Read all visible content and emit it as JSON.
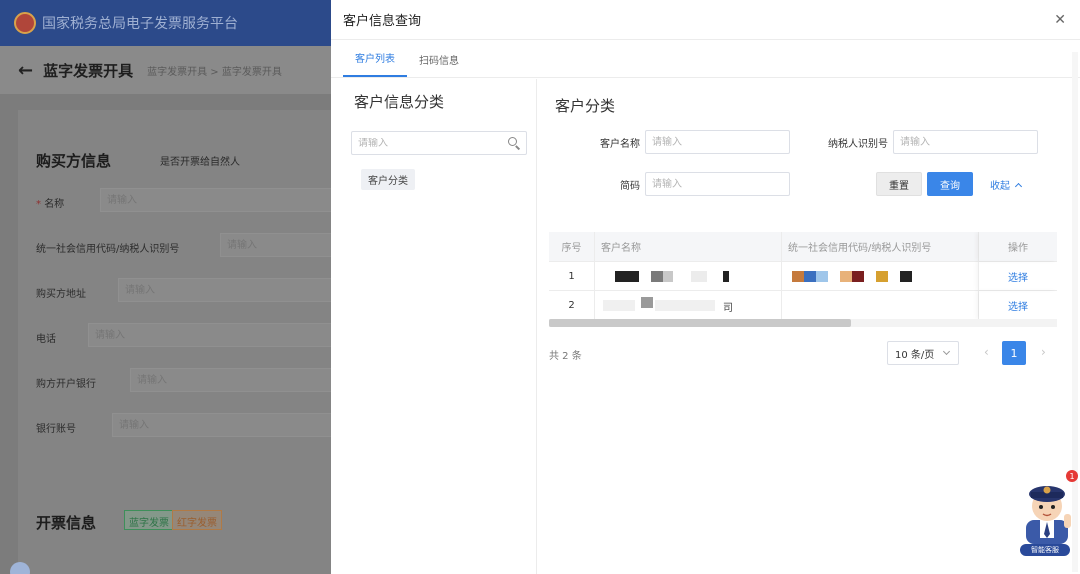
{
  "background": {
    "platform_title": "国家税务总局电子发票服务平台",
    "page_title": "蓝字发票开具",
    "breadcrumb": [
      "蓝字发票开具",
      "蓝字发票开具"
    ],
    "buyer_section_title": "购买方信息",
    "natural_person_label": "是否开票给自然人",
    "placeholder": "请输入",
    "fields": [
      {
        "label": "名称",
        "required": true
      },
      {
        "label": "统一社会信用代码/纳税人识别号"
      },
      {
        "label": "购买方地址"
      },
      {
        "label": "电话"
      },
      {
        "label": "购方开户银行"
      },
      {
        "label": "银行账号"
      }
    ],
    "invoice_section_title": "开票信息",
    "invoice_tags": [
      "蓝字发票",
      "红字发票"
    ]
  },
  "modal": {
    "title": "客户信息查询",
    "close_icon": "close-icon",
    "tabs": [
      {
        "label": "客户列表",
        "active": true
      },
      {
        "label": "扫码信息",
        "active": false
      }
    ],
    "left": {
      "heading": "客户信息分类",
      "search_placeholder": "请输入",
      "tree_node": "客户分类"
    },
    "right": {
      "heading": "客户分类",
      "form": {
        "customer_name_label": "客户名称",
        "customer_name_placeholder": "请输入",
        "tax_id_label": "纳税人识别号",
        "tax_id_placeholder": "请输入",
        "short_code_label": "简码",
        "short_code_placeholder": "请输入",
        "reset_label": "重置",
        "query_label": "查询",
        "collapse_label": "收起"
      },
      "table": {
        "columns": [
          "序号",
          "客户名称",
          "统一社会信用代码/纳税人识别号",
          "操作"
        ],
        "rows": [
          {
            "index": "1",
            "name": "",
            "tax_id": "",
            "action": "选择"
          },
          {
            "index": "2",
            "name": "司",
            "tax_id": "",
            "action": "选择"
          }
        ]
      },
      "pagination": {
        "total": "共 2 条",
        "page_size": "10 条/页",
        "current_page": "1"
      }
    }
  },
  "assistant": {
    "badge_count": "1",
    "caption": "智能客服"
  },
  "colors": {
    "accent": "#3a86e8",
    "header_bg": "#2c4a8a",
    "overlay_bg": "#7c7c7c"
  }
}
